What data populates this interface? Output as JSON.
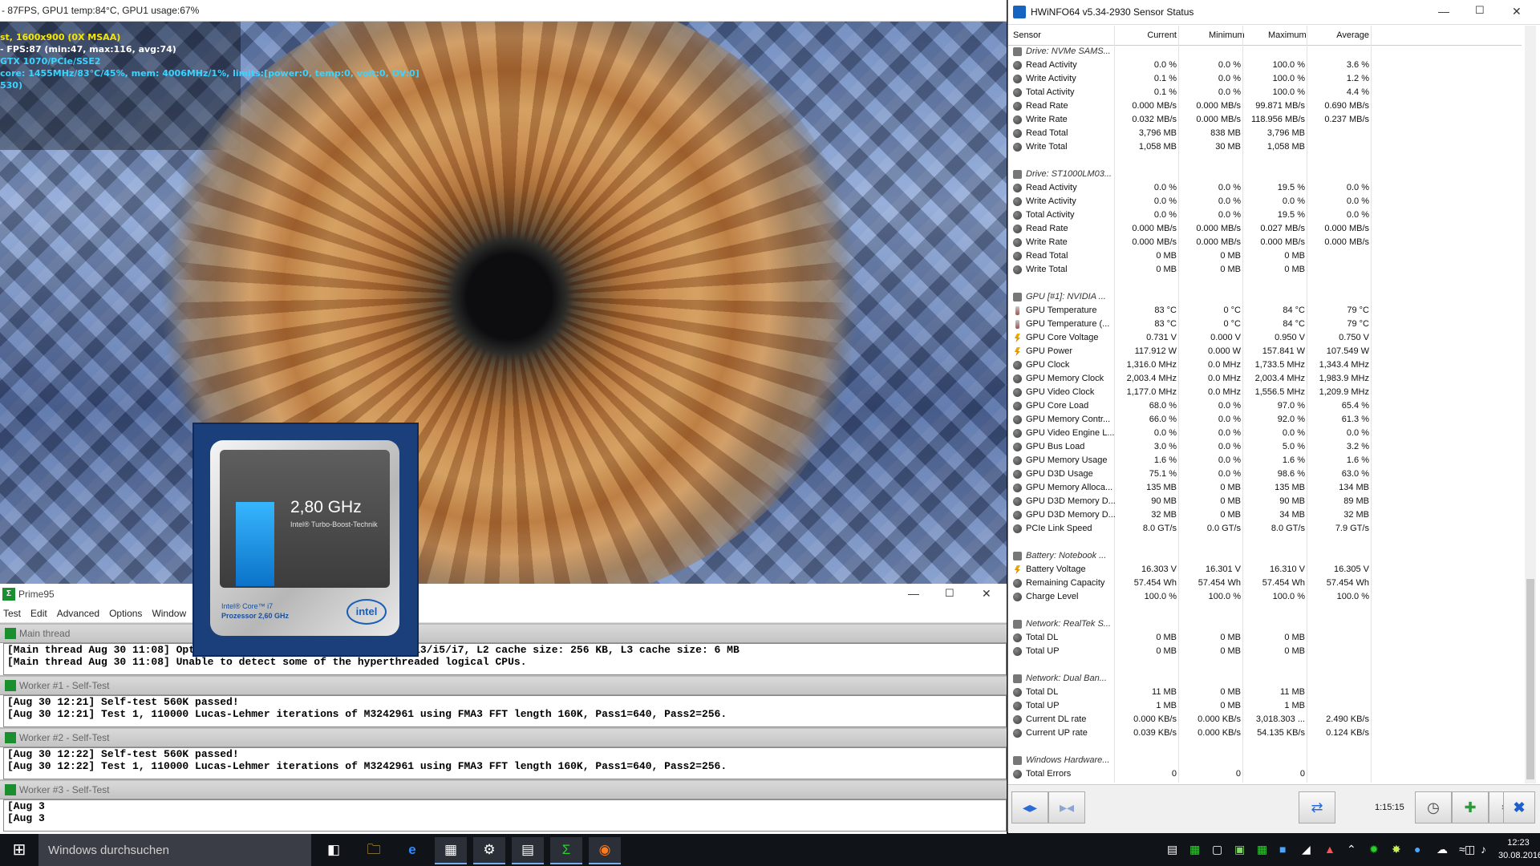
{
  "osd": {
    "title": "- 87FPS, GPU1 temp:84°C, GPU1 usage:67%",
    "lines": [
      {
        "text": "st, 1600x900 (0X MSAA)",
        "color": "#f7e600"
      },
      {
        "text": "- FPS:87 (min:47, max:116, avg:74)",
        "color": "#ffffff"
      },
      {
        "text": "GTX 1070/PCIe/SSE2",
        "color": "#3ad4ff"
      },
      {
        "text": "core: 1455MHz/83°C/45%, mem: 4006MHz/1%, limits:[power:0, temp:0, volt:0, OV:0]",
        "color": "#3ad4ff"
      },
      {
        "text": "530)",
        "color": "#3ad4ff"
      }
    ]
  },
  "intel": {
    "ghz": "2,80 GHz",
    "turbo": "Intel® Turbo-Boost-Technik",
    "cpu_line1": "Intel® Core™ i7",
    "cpu_line2": "Prozessor 2,60 GHz",
    "logo": "intel"
  },
  "prime95": {
    "title": "Prime95",
    "menu": [
      "Test",
      "Edit",
      "Advanced",
      "Options",
      "Window"
    ],
    "panes": [
      {
        "title": "Main thread",
        "lines": [
          "[Main thread Aug 30 11:08] Optimizing for CPU architecture: Core i3/i5/i7, L2 cache size: 256 KB, L3 cache size: 6 MB",
          "[Main thread Aug 30 11:08] Unable to detect some of the hyperthreaded logical CPUs."
        ]
      },
      {
        "title": "Worker #1 - Self-Test",
        "lines": [
          "[Aug 30 12:21] Self-test 560K passed!",
          "[Aug 30 12:21] Test 1, 110000 Lucas-Lehmer iterations of M3242961 using FMA3 FFT length 160K, Pass1=640, Pass2=256."
        ]
      },
      {
        "title": "Worker #2 - Self-Test",
        "lines": [
          "[Aug 30 12:22] Self-test 560K passed!",
          "[Aug 30 12:22] Test 1, 110000 Lucas-Lehmer iterations of M3242961 using FMA3 FFT length 160K, Pass1=640, Pass2=256."
        ]
      },
      {
        "title": "Worker #3 - Self-Test",
        "lines": [
          "[Aug 3",
          "[Aug 3"
        ]
      }
    ]
  },
  "hwinfo": {
    "title": "HWiNFO64 v5.34-2930 Sensor Status",
    "columns": [
      "Sensor",
      "Current",
      "Minimum",
      "Maximum",
      "Average"
    ],
    "time": "1:15:15",
    "rows": [
      {
        "group": true,
        "label": "Drive: NVMe SAMS..."
      },
      {
        "label": "Read Activity",
        "cur": "0.0 %",
        "min": "0.0 %",
        "max": "100.0 %",
        "avg": "3.6 %"
      },
      {
        "label": "Write Activity",
        "cur": "0.1 %",
        "min": "0.0 %",
        "max": "100.0 %",
        "avg": "1.2 %"
      },
      {
        "label": "Total Activity",
        "cur": "0.1 %",
        "min": "0.0 %",
        "max": "100.0 %",
        "avg": "4.4 %"
      },
      {
        "label": "Read Rate",
        "cur": "0.000 MB/s",
        "min": "0.000 MB/s",
        "max": "99.871 MB/s",
        "avg": "0.690 MB/s"
      },
      {
        "label": "Write Rate",
        "cur": "0.032 MB/s",
        "min": "0.000 MB/s",
        "max": "118.956 MB/s",
        "avg": "0.237 MB/s"
      },
      {
        "label": "Read Total",
        "cur": "3,796 MB",
        "min": "838 MB",
        "max": "3,796 MB",
        "avg": ""
      },
      {
        "label": "Write Total",
        "cur": "1,058 MB",
        "min": "30 MB",
        "max": "1,058 MB",
        "avg": ""
      },
      {
        "gap": true
      },
      {
        "group": true,
        "label": "Drive: ST1000LM03..."
      },
      {
        "label": "Read Activity",
        "cur": "0.0 %",
        "min": "0.0 %",
        "max": "19.5 %",
        "avg": "0.0 %"
      },
      {
        "label": "Write Activity",
        "cur": "0.0 %",
        "min": "0.0 %",
        "max": "0.0 %",
        "avg": "0.0 %"
      },
      {
        "label": "Total Activity",
        "cur": "0.0 %",
        "min": "0.0 %",
        "max": "19.5 %",
        "avg": "0.0 %"
      },
      {
        "label": "Read Rate",
        "cur": "0.000 MB/s",
        "min": "0.000 MB/s",
        "max": "0.027 MB/s",
        "avg": "0.000 MB/s"
      },
      {
        "label": "Write Rate",
        "cur": "0.000 MB/s",
        "min": "0.000 MB/s",
        "max": "0.000 MB/s",
        "avg": "0.000 MB/s"
      },
      {
        "label": "Read Total",
        "cur": "0 MB",
        "min": "0 MB",
        "max": "0 MB",
        "avg": ""
      },
      {
        "label": "Write Total",
        "cur": "0 MB",
        "min": "0 MB",
        "max": "0 MB",
        "avg": ""
      },
      {
        "gap": true
      },
      {
        "group": true,
        "label": "GPU [#1]: NVIDIA ..."
      },
      {
        "label": "GPU Temperature",
        "icon": "t",
        "cur": "83 °C",
        "min": "0 °C",
        "max": "84 °C",
        "avg": "79 °C"
      },
      {
        "label": "GPU Temperature (...",
        "icon": "t",
        "cur": "83 °C",
        "min": "0 °C",
        "max": "84 °C",
        "avg": "79 °C"
      },
      {
        "label": "GPU Core Voltage",
        "icon": "b",
        "cur": "0.731 V",
        "min": "0.000 V",
        "max": "0.950 V",
        "avg": "0.750 V"
      },
      {
        "label": "GPU Power",
        "icon": "b",
        "cur": "117.912 W",
        "min": "0.000 W",
        "max": "157.841 W",
        "avg": "107.549 W"
      },
      {
        "label": "GPU Clock",
        "cur": "1,316.0 MHz",
        "min": "0.0 MHz",
        "max": "1,733.5 MHz",
        "avg": "1,343.4 MHz"
      },
      {
        "label": "GPU Memory Clock",
        "cur": "2,003.4 MHz",
        "min": "0.0 MHz",
        "max": "2,003.4 MHz",
        "avg": "1,983.9 MHz"
      },
      {
        "label": "GPU Video Clock",
        "cur": "1,177.0 MHz",
        "min": "0.0 MHz",
        "max": "1,556.5 MHz",
        "avg": "1,209.9 MHz"
      },
      {
        "label": "GPU Core Load",
        "cur": "68.0 %",
        "min": "0.0 %",
        "max": "97.0 %",
        "avg": "65.4 %"
      },
      {
        "label": "GPU Memory Contr...",
        "cur": "66.0 %",
        "min": "0.0 %",
        "max": "92.0 %",
        "avg": "61.3 %"
      },
      {
        "label": "GPU Video Engine L...",
        "cur": "0.0 %",
        "min": "0.0 %",
        "max": "0.0 %",
        "avg": "0.0 %"
      },
      {
        "label": "GPU Bus Load",
        "cur": "3.0 %",
        "min": "0.0 %",
        "max": "5.0 %",
        "avg": "3.2 %"
      },
      {
        "label": "GPU Memory Usage",
        "cur": "1.6 %",
        "min": "0.0 %",
        "max": "1.6 %",
        "avg": "1.6 %"
      },
      {
        "label": "GPU D3D Usage",
        "cur": "75.1 %",
        "min": "0.0 %",
        "max": "98.6 %",
        "avg": "63.0 %"
      },
      {
        "label": "GPU Memory Alloca...",
        "cur": "135 MB",
        "min": "0 MB",
        "max": "135 MB",
        "avg": "134 MB"
      },
      {
        "label": "GPU D3D Memory D...",
        "cur": "90 MB",
        "min": "0 MB",
        "max": "90 MB",
        "avg": "89 MB"
      },
      {
        "label": "GPU D3D Memory D...",
        "cur": "32 MB",
        "min": "0 MB",
        "max": "34 MB",
        "avg": "32 MB"
      },
      {
        "label": "PCIe Link Speed",
        "cur": "8.0 GT/s",
        "min": "0.0 GT/s",
        "max": "8.0 GT/s",
        "avg": "7.9 GT/s"
      },
      {
        "gap": true
      },
      {
        "group": true,
        "label": "Battery: Notebook ..."
      },
      {
        "label": "Battery Voltage",
        "icon": "b",
        "cur": "16.303 V",
        "min": "16.301 V",
        "max": "16.310 V",
        "avg": "16.305 V"
      },
      {
        "label": "Remaining Capacity",
        "cur": "57.454 Wh",
        "min": "57.454 Wh",
        "max": "57.454 Wh",
        "avg": "57.454 Wh"
      },
      {
        "label": "Charge Level",
        "cur": "100.0 %",
        "min": "100.0 %",
        "max": "100.0 %",
        "avg": "100.0 %"
      },
      {
        "gap": true
      },
      {
        "group": true,
        "label": "Network: RealTek S..."
      },
      {
        "label": "Total DL",
        "cur": "0 MB",
        "min": "0 MB",
        "max": "0 MB",
        "avg": ""
      },
      {
        "label": "Total UP",
        "cur": "0 MB",
        "min": "0 MB",
        "max": "0 MB",
        "avg": ""
      },
      {
        "gap": true
      },
      {
        "group": true,
        "label": "Network: Dual Ban..."
      },
      {
        "label": "Total DL",
        "cur": "11 MB",
        "min": "0 MB",
        "max": "11 MB",
        "avg": ""
      },
      {
        "label": "Total UP",
        "cur": "1 MB",
        "min": "0 MB",
        "max": "1 MB",
        "avg": ""
      },
      {
        "label": "Current DL rate",
        "cur": "0.000 KB/s",
        "min": "0.000 KB/s",
        "max": "3,018.303 ...",
        "avg": "2.490 KB/s"
      },
      {
        "label": "Current UP rate",
        "cur": "0.039 KB/s",
        "min": "0.000 KB/s",
        "max": "54.135 KB/s",
        "avg": "0.124 KB/s"
      },
      {
        "gap": true
      },
      {
        "group": true,
        "label": "Windows Hardware..."
      },
      {
        "label": "Total Errors",
        "cur": "0",
        "min": "0",
        "max": "0",
        "avg": ""
      }
    ]
  },
  "taskbar": {
    "search_placeholder": "Windows durchsuchen",
    "clock_time": "12:23",
    "clock_date": "30.08.2016"
  },
  "icons": {
    "start": "windows-logo-icon",
    "task_view": "task-view-icon",
    "explorer": "folder-icon",
    "edge": "edge-browser-icon"
  }
}
